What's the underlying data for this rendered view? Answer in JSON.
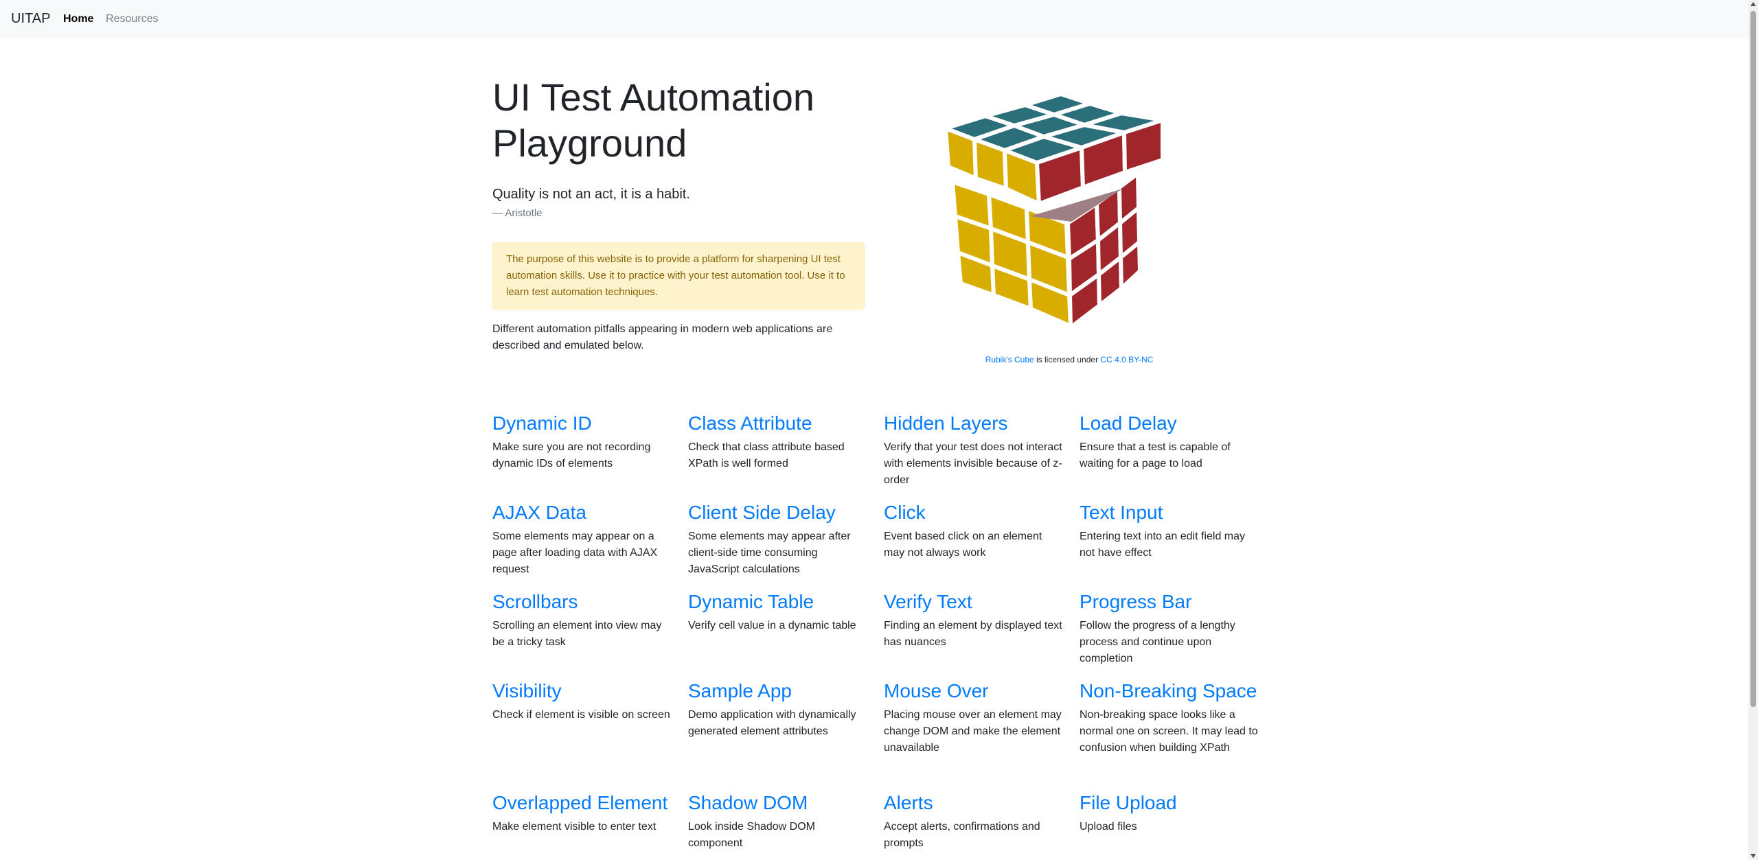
{
  "navbar": {
    "brand": "UITAP",
    "links": [
      {
        "label": "Home",
        "active": true
      },
      {
        "label": "Resources",
        "active": false
      }
    ]
  },
  "hero": {
    "title": "UI Test Automation Playground",
    "quote": "Quality is not an act, it is a habit.",
    "quote_author": "— Aristotle",
    "alert": "The purpose of this website is to provide a platform for sharpening UI test automation skills. Use it to practice with your test automation tool. Use it to learn test automation techniques.",
    "intro": "Different automation pitfalls appearing in modern web applications are described and emulated below."
  },
  "image_credit": {
    "link_text": "Rubik's Cube",
    "middle_text": " is licensed under ",
    "license_text": "CC 4.0 BY-NC"
  },
  "colors": {
    "link": "#007bff",
    "alert_bg": "#fff3cd",
    "alert_text": "#856404",
    "cube_top": "#2b6f7b",
    "cube_left": "#d9ad00",
    "cube_right": "#a0262b"
  },
  "cards": [
    {
      "title": "Dynamic ID",
      "desc": "Make sure you are not recording dynamic IDs of elements"
    },
    {
      "title": "Class Attribute",
      "desc": "Check that class attribute based XPath is well formed"
    },
    {
      "title": "Hidden Layers",
      "desc": "Verify that your test does not interact with elements invisible because of z-order"
    },
    {
      "title": "Load Delay",
      "desc": "Ensure that a test is capable of waiting for a page to load"
    },
    {
      "title": "AJAX Data",
      "desc": "Some elements may appear on a page after loading data with AJAX request"
    },
    {
      "title": "Client Side Delay",
      "desc": "Some elements may appear after client-side time consuming JavaScript calculations"
    },
    {
      "title": "Click",
      "desc": "Event based click on an element may not always work"
    },
    {
      "title": "Text Input",
      "desc": "Entering text into an edit field may not have effect"
    },
    {
      "title": "Scrollbars",
      "desc": "Scrolling an element into view may be a tricky task"
    },
    {
      "title": "Dynamic Table",
      "desc": "Verify cell value in a dynamic table"
    },
    {
      "title": "Verify Text",
      "desc": "Finding an element by displayed text has nuances"
    },
    {
      "title": "Progress Bar",
      "desc": "Follow the progress of a lengthy process and continue upon completion"
    },
    {
      "title": "Visibility",
      "desc": "Check if element is visible on screen"
    },
    {
      "title": "Sample App",
      "desc": "Demo application with dynamically generated element attributes"
    },
    {
      "title": "Mouse Over",
      "desc": "Placing mouse over an element may change DOM and make the element unavailable"
    },
    {
      "title": "Non-Breaking Space",
      "desc": "Non-breaking space looks like a normal one on screen. It may lead to confusion when building XPath"
    },
    {
      "title": "Overlapped Element",
      "desc": "Make element visible to enter text"
    },
    {
      "title": "Shadow DOM",
      "desc": "Look inside Shadow DOM component"
    },
    {
      "title": "Alerts",
      "desc": "Accept alerts, confirmations and prompts"
    },
    {
      "title": "File Upload",
      "desc": "Upload files"
    }
  ]
}
